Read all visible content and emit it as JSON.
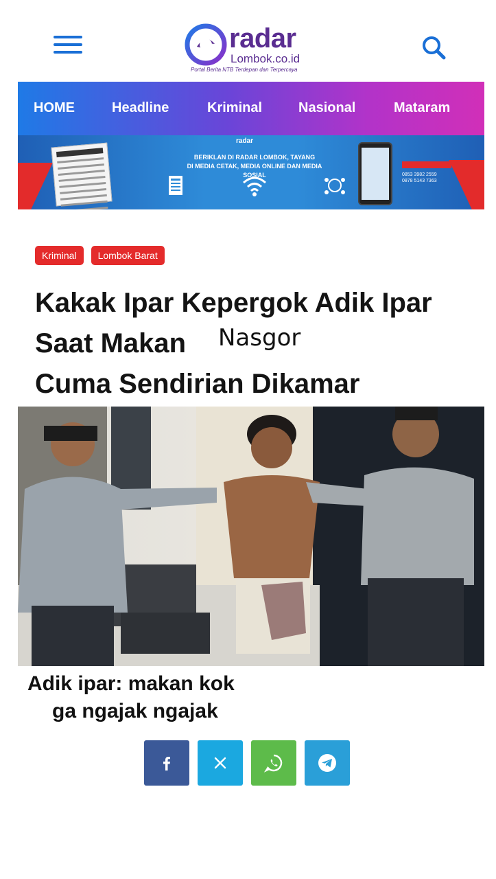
{
  "site": {
    "logo_name": "radar",
    "logo_domain": "Lombok.co.id",
    "tagline": "Portal Berita NTB Terdepan dan Terpercaya"
  },
  "header": {
    "menu_icon": "hamburger-menu-icon",
    "search_icon": "search-icon"
  },
  "nav": {
    "items": [
      "HOME",
      "Headline",
      "Kriminal",
      "Nasional",
      "Mataram"
    ]
  },
  "ad_banner": {
    "logo": "radar",
    "text_line1": "BERIKLAN DI RADAR LOMBOK, TAYANG",
    "text_line2": "DI MEDIA CETAK, MEDIA ONLINE DAN MEDIA SOSIAL",
    "phone1": "0853 3982 2559",
    "phone2": "0878 5143 7363"
  },
  "article": {
    "tags": [
      "Kriminal",
      "Lombok Barat"
    ],
    "title_line1": "Kakak Ipar Kepergok Adik Ipar",
    "title_line2": "Saat Makan",
    "title_line3": "Cuma Sendirian Dikamar",
    "handwritten_word": "Nasgor",
    "caption_line1": "Adik ipar: makan kok",
    "caption_line2": "ga ngajak ngajak"
  },
  "share": {
    "buttons": [
      {
        "icon": "facebook-icon",
        "color": "#3b5998"
      },
      {
        "icon": "x-twitter-icon",
        "color": "#1ba8e0"
      },
      {
        "icon": "whatsapp-icon",
        "color": "#5dbb4a"
      },
      {
        "icon": "telegram-icon",
        "color": "#2a9fd8"
      }
    ]
  },
  "colors": {
    "brand_purple": "#5a2d91",
    "accent_blue": "#1a6fd6",
    "tag_red": "#e42b2b"
  }
}
